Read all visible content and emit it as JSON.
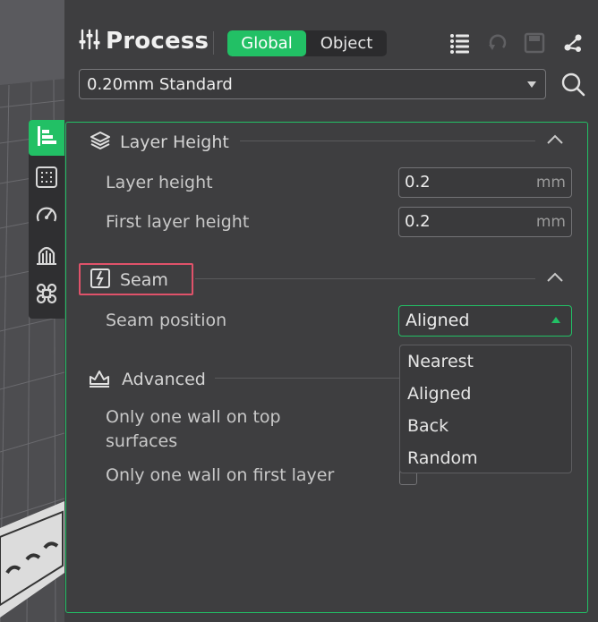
{
  "header": {
    "title": "Process",
    "toggle": {
      "active": "Global",
      "inactive": "Object"
    },
    "icons": [
      "sliders-icon",
      "list-icon",
      "undo-icon",
      "save-icon",
      "share-nodes-icon"
    ]
  },
  "preset": {
    "value": "0.20mm Standard"
  },
  "sidebar_tabs": [
    "quality-icon",
    "strength-icon",
    "speed-icon",
    "support-icon",
    "others-icon"
  ],
  "sections": {
    "layer_height": {
      "title": "Layer Height",
      "fields": [
        {
          "label": "Layer height",
          "value": "0.2",
          "unit": "mm"
        },
        {
          "label": "First layer height",
          "value": "0.2",
          "unit": "mm"
        }
      ]
    },
    "seam": {
      "title": "Seam",
      "position_label": "Seam position",
      "position_value": "Aligned",
      "options": [
        "Nearest",
        "Aligned",
        "Back",
        "Random"
      ]
    },
    "advanced": {
      "title": "Advanced",
      "field1_line1": "Only one wall on top",
      "field1_line2": "surfaces",
      "field2": "Only one wall on first layer"
    }
  },
  "colors": {
    "accent": "#22c065",
    "highlight": "#e0526a",
    "panel": "#3e3e40"
  }
}
